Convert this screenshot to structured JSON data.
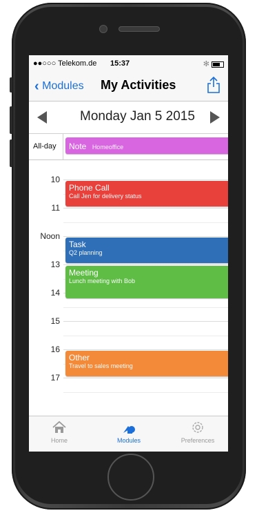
{
  "status": {
    "carrier": "●●○○○ Telekom.de",
    "time": "15:37"
  },
  "nav": {
    "back_label": "Modules",
    "title": "My Activities"
  },
  "date": {
    "label": "Monday Jan 5 2015"
  },
  "allday": {
    "label": "All-day",
    "event": {
      "title": "Note",
      "desc": "Homeoffice",
      "color": "#d866e0"
    }
  },
  "hours": [
    "10",
    "11",
    "Noon",
    "13",
    "14",
    "15",
    "16",
    "17"
  ],
  "events": [
    {
      "title": "Phone Call",
      "desc": "Call Jen for delivery status",
      "color": "#e8413c",
      "start": "10:00",
      "end": "11:00"
    },
    {
      "title": "Task",
      "desc": "Q2 planning",
      "color": "#2f6fb8",
      "start": "12:00",
      "end": "13:00"
    },
    {
      "title": "Meeting",
      "desc": "Lunch meeting with Bob",
      "color": "#5fbd46",
      "start": "13:00",
      "end": "14:15"
    },
    {
      "title": "Other",
      "desc": "Travel to sales meeting",
      "color": "#f28a3a",
      "start": "16:00",
      "end": "17:00"
    }
  ],
  "tabs": [
    {
      "label": "Home",
      "icon": "home-icon",
      "active": false
    },
    {
      "label": "Modules",
      "icon": "modules-icon",
      "active": true
    },
    {
      "label": "Preferences",
      "icon": "gear-icon",
      "active": false
    }
  ]
}
